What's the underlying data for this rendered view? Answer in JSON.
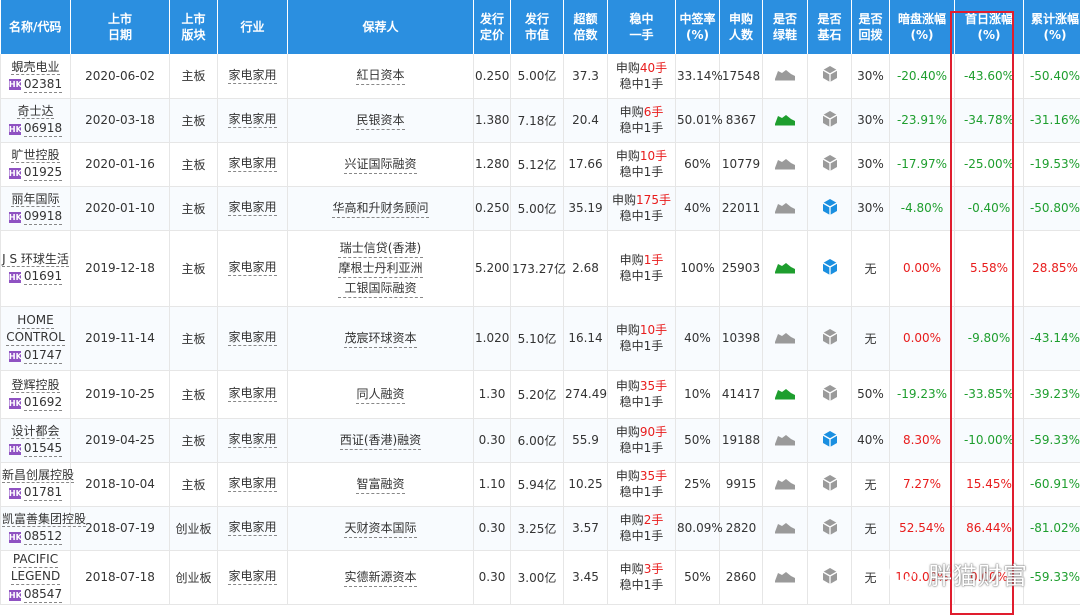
{
  "headers": [
    "名称/代码",
    "上市\n日期",
    "上市\n版块",
    "行业",
    "保荐人",
    "发行\n定价",
    "发行\n市值",
    "超额\n倍数",
    "稳中\n一手",
    "中签率\n(%)",
    "申购\n人数",
    "是否\n绿鞋",
    "是否\n基石",
    "是否\n回拨",
    "暗盘涨幅\n(%)",
    "首日涨幅\n(%)",
    "累计涨幅\n(%)"
  ],
  "hk_badge": "HK",
  "rows": [
    {
      "name": "蜆壳电业",
      "code": "02381",
      "date": "2020-06-02",
      "board": "主板",
      "industry": "家电家用",
      "sponsors": [
        "紅日资本"
      ],
      "price": "0.250",
      "mktcap": "5.00亿",
      "oversub": "37.3",
      "wenzhong_pre": "申购",
      "wenzhong_num": "40手",
      "wenzhong_post": "稳中1手",
      "rate": "33.14%",
      "applicants": "17548",
      "greenshoe": "gray",
      "cornerstone": "gray",
      "clawback": "30%",
      "dark": "-20.40%",
      "dark_color": "green",
      "first": "-43.60%",
      "first_color": "green",
      "cum": "-50.40%",
      "cum_color": "green"
    },
    {
      "name": "奇士达",
      "code": "06918",
      "date": "2020-03-18",
      "board": "主板",
      "industry": "家电家用",
      "sponsors": [
        "民银资本"
      ],
      "price": "1.380",
      "mktcap": "7.18亿",
      "oversub": "20.4",
      "wenzhong_pre": "申购",
      "wenzhong_num": "6手",
      "wenzhong_post": "稳中1手",
      "rate": "50.01%",
      "applicants": "8367",
      "greenshoe": "green",
      "cornerstone": "gray",
      "clawback": "30%",
      "dark": "-23.91%",
      "dark_color": "green",
      "first": "-34.78%",
      "first_color": "green",
      "cum": "-31.16%",
      "cum_color": "green"
    },
    {
      "name": "旷世控股",
      "code": "01925",
      "date": "2020-01-16",
      "board": "主板",
      "industry": "家电家用",
      "sponsors": [
        "兴证国际融资"
      ],
      "price": "1.280",
      "mktcap": "5.12亿",
      "oversub": "17.66",
      "wenzhong_pre": "申购",
      "wenzhong_num": "10手",
      "wenzhong_post": "稳中1手",
      "rate": "60%",
      "applicants": "10779",
      "greenshoe": "gray",
      "cornerstone": "gray",
      "clawback": "30%",
      "dark": "-17.97%",
      "dark_color": "green",
      "first": "-25.00%",
      "first_color": "green",
      "cum": "-19.53%",
      "cum_color": "green"
    },
    {
      "name": "丽年国际",
      "code": "09918",
      "date": "2020-01-10",
      "board": "主板",
      "industry": "家电家用",
      "sponsors": [
        "华高和升财务顾问"
      ],
      "price": "0.250",
      "mktcap": "5.00亿",
      "oversub": "35.19",
      "wenzhong_pre": "申购",
      "wenzhong_num": "175手",
      "wenzhong_post": "稳中1手",
      "rate": "40%",
      "applicants": "22011",
      "greenshoe": "gray",
      "cornerstone": "blue",
      "clawback": "30%",
      "dark": "-4.80%",
      "dark_color": "green",
      "first": "-0.40%",
      "first_color": "green",
      "cum": "-50.80%",
      "cum_color": "green"
    },
    {
      "name": "J S 环球生活",
      "code": "01691",
      "date": "2019-12-18",
      "board": "主板",
      "industry": "家电家用",
      "sponsors": [
        "瑞士信贷(香港)",
        "摩根士丹利亚洲",
        "工银国际融资"
      ],
      "price": "5.200",
      "mktcap": "173.27亿",
      "oversub": "2.68",
      "wenzhong_pre": "申购",
      "wenzhong_num": "1手",
      "wenzhong_post": "稳中1手",
      "rate": "100%",
      "applicants": "25903",
      "greenshoe": "green",
      "cornerstone": "blue",
      "clawback": "无",
      "dark": "0.00%",
      "dark_color": "red",
      "first": "5.58%",
      "first_color": "red",
      "cum": "28.85%",
      "cum_color": "red"
    },
    {
      "name": "HOME CONTROL",
      "name_lines": [
        "HOME",
        "CONTROL"
      ],
      "code": "01747",
      "date": "2019-11-14",
      "board": "主板",
      "industry": "家电家用",
      "sponsors": [
        "茂宸环球资本"
      ],
      "price": "1.020",
      "mktcap": "5.10亿",
      "oversub": "16.14",
      "wenzhong_pre": "申购",
      "wenzhong_num": "10手",
      "wenzhong_post": "稳中1手",
      "rate": "40%",
      "applicants": "10398",
      "greenshoe": "gray",
      "cornerstone": "gray",
      "clawback": "无",
      "dark": "0.00%",
      "dark_color": "red",
      "first": "-9.80%",
      "first_color": "green",
      "cum": "-43.14%",
      "cum_color": "green"
    },
    {
      "name": "登辉控股",
      "code": "01692",
      "date": "2019-10-25",
      "board": "主板",
      "industry": "家电家用",
      "sponsors": [
        "同人融资"
      ],
      "price": "1.30",
      "mktcap": "5.20亿",
      "oversub": "274.49",
      "wenzhong_pre": "申购",
      "wenzhong_num": "35手",
      "wenzhong_post": "稳中1手",
      "rate": "10%",
      "applicants": "41417",
      "greenshoe": "green",
      "cornerstone": "gray",
      "clawback": "50%",
      "dark": "-19.23%",
      "dark_color": "green",
      "first": "-33.85%",
      "first_color": "green",
      "cum": "-39.23%",
      "cum_color": "green"
    },
    {
      "name": "设计都会",
      "code": "01545",
      "date": "2019-04-25",
      "board": "主板",
      "industry": "家电家用",
      "sponsors": [
        "西证(香港)融资"
      ],
      "price": "0.30",
      "mktcap": "6.00亿",
      "oversub": "55.9",
      "wenzhong_pre": "申购",
      "wenzhong_num": "90手",
      "wenzhong_post": "稳中1手",
      "rate": "50%",
      "applicants": "19188",
      "greenshoe": "gray",
      "cornerstone": "blue",
      "clawback": "40%",
      "dark": "8.30%",
      "dark_color": "red",
      "first": "-10.00%",
      "first_color": "green",
      "cum": "-59.33%",
      "cum_color": "green"
    },
    {
      "name": "新昌创展控股",
      "code": "01781",
      "date": "2018-10-04",
      "board": "主板",
      "industry": "家电家用",
      "sponsors": [
        "智富融资"
      ],
      "price": "1.10",
      "mktcap": "5.94亿",
      "oversub": "10.25",
      "wenzhong_pre": "申购",
      "wenzhong_num": "35手",
      "wenzhong_post": "稳中1手",
      "rate": "25%",
      "applicants": "9915",
      "greenshoe": "gray",
      "cornerstone": "gray",
      "clawback": "无",
      "dark": "7.27%",
      "dark_color": "red",
      "first": "15.45%",
      "first_color": "red",
      "cum": "-60.91%",
      "cum_color": "green"
    },
    {
      "name": "凯富善集团控股",
      "code": "08512",
      "date": "2018-07-19",
      "board": "创业板",
      "industry": "家电家用",
      "sponsors": [
        "天财资本国际"
      ],
      "price": "0.30",
      "mktcap": "3.25亿",
      "oversub": "3.57",
      "wenzhong_pre": "申购",
      "wenzhong_num": "2手",
      "wenzhong_post": "稳中1手",
      "rate": "80.09%",
      "applicants": "2820",
      "greenshoe": "gray",
      "cornerstone": "gray",
      "clawback": "无",
      "dark": "52.54%",
      "dark_color": "red",
      "first": "86.44%",
      "first_color": "red",
      "cum": "-81.02%",
      "cum_color": "green"
    },
    {
      "name": "PACIFIC LEGEND",
      "name_lines": [
        "PACIFIC",
        "LEGEND"
      ],
      "code": "08547",
      "date": "2018-07-18",
      "board": "创业板",
      "industry": "家电家用",
      "sponsors": [
        "实德新源资本"
      ],
      "price": "0.30",
      "mktcap": "3.00亿",
      "oversub": "3.45",
      "wenzhong_pre": "申购",
      "wenzhong_num": "3手",
      "wenzhong_post": "稳中1手",
      "rate": "50%",
      "applicants": "2860",
      "greenshoe": "gray",
      "cornerstone": "gray",
      "clawback": "无",
      "dark": "100.00%",
      "dark_color": "red",
      "first": "0.00%",
      "first_color": "red",
      "cum": "-59.33%",
      "cum_color": "green"
    }
  ],
  "watermark": "胖猫财富",
  "colors": {
    "header_bg": "#2b8fe0",
    "red": "#e81c1c",
    "green": "#1e9e2e",
    "highlight_border": "#e01d2e",
    "hk_badge": "#8f52c2",
    "greenshoe_on": "#1e9e2e",
    "greenshoe_off": "#9a9a9a",
    "cornerstone_on": "#1a8fe0",
    "cornerstone_off": "#9a9a9a"
  }
}
